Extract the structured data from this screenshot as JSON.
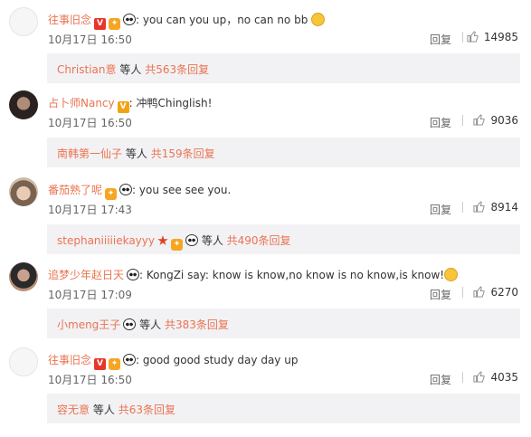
{
  "comments": [
    {
      "username": "往事旧念",
      "text": ": you can you up，no can no bb",
      "date": "10月17日 16:50",
      "reply_label": "回复",
      "likes": "14985",
      "sub": {
        "name": "Christian意",
        "mid": "等人",
        "count": "共563条回复"
      }
    },
    {
      "username": "占卜师Nancy",
      "text": ": 冲鸭Chinglish!",
      "date": "10月17日 16:50",
      "reply_label": "回复",
      "likes": "9036",
      "sub": {
        "name": "南韩第一仙子",
        "mid": "等人",
        "count": "共159条回复"
      }
    },
    {
      "username": "番茄熟了呢",
      "text": ": you see see you.",
      "date": "10月17日 17:43",
      "reply_label": "回复",
      "likes": "8914",
      "sub": {
        "name": "stephaniiiiiekayyy",
        "mid": "等人",
        "count": "共490条回复"
      }
    },
    {
      "username": "追梦少年赵日天",
      "text": ": KongZi say: know is know,no know is no know,is know!",
      "date": "10月17日 17:09",
      "reply_label": "回复",
      "likes": "6270",
      "sub": {
        "name": "小meng王子",
        "mid": "等人",
        "count": "共383条回复"
      }
    },
    {
      "username": "往事旧念",
      "text": ": good good study day day up",
      "date": "10月17日 16:50",
      "reply_label": "回复",
      "likes": "4035",
      "sub": {
        "name": "容无意",
        "mid": "等人",
        "count": "共63条回复"
      }
    }
  ]
}
